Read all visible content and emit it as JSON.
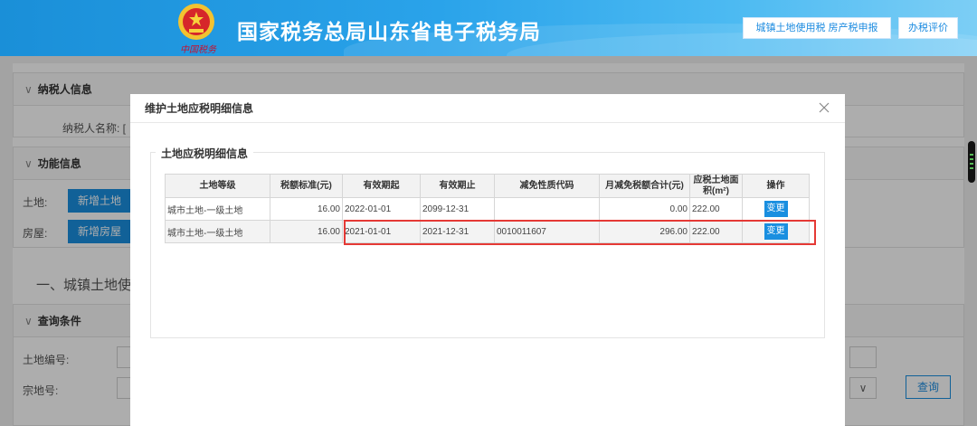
{
  "header": {
    "title": "国家税务总局山东省电子税务局",
    "script_text": "中国税务",
    "buttons": [
      "城镇土地使用税 房产税申报",
      "办税评价"
    ]
  },
  "background": {
    "taxpayer": {
      "heading": "纳税人信息",
      "name_label": "纳税人名称: ["
    },
    "function": {
      "heading": "功能信息",
      "land_label": "土地:",
      "add_land": "新增土地",
      "house_label": "房屋:",
      "add_house": "新增房屋"
    },
    "section_title": "一、城镇土地使",
    "query": {
      "heading": "查询条件",
      "land_no_label": "土地编号:",
      "parcel_label": "宗地号:",
      "query_btn": "查询"
    }
  },
  "modal": {
    "title": "维护土地应税明细信息",
    "legend": "土地应税明细信息",
    "columns": [
      "土地等级",
      "税额标准(元)",
      "有效期起",
      "有效期止",
      "减免性质代码",
      "月减免税额合计(元)",
      "应税土地面积(m²)",
      "操作"
    ],
    "rows": [
      {
        "grade": "城市土地-一级土地",
        "rate": "16.00",
        "start": "2022-01-01",
        "end": "2099-12-31",
        "code": "",
        "relief": "0.00",
        "area": "222.00",
        "action": "变更"
      },
      {
        "grade": "城市土地-一级土地",
        "rate": "16.00",
        "start": "2021-01-01",
        "end": "2021-12-31",
        "code": "0010011607",
        "relief": "296.00",
        "area": "222.00",
        "action": "变更"
      }
    ]
  },
  "colors": {
    "accent": "#1a8fe0",
    "highlight": "#e53935"
  },
  "icons": {
    "close": "close-icon",
    "chevron": "chevron-down-icon",
    "emblem": "tax-emblem-icon"
  }
}
